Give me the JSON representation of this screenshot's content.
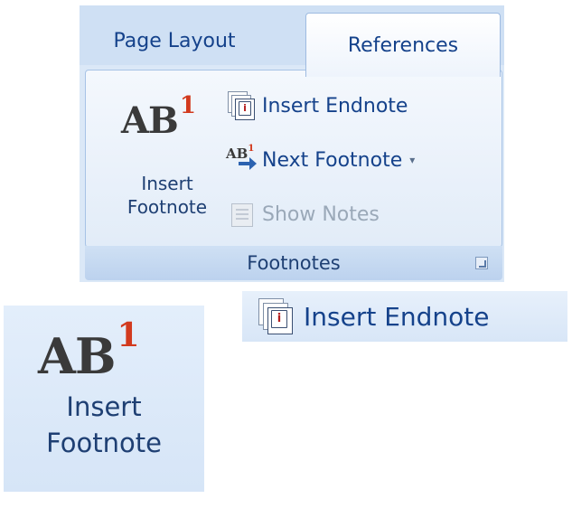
{
  "ribbon": {
    "tabs": [
      {
        "label": "Page Layout"
      },
      {
        "label": "References"
      }
    ],
    "group": {
      "label": "Footnotes",
      "insert_footnote": {
        "glyph": "AB",
        "superscript": "1",
        "label": "Insert\nFootnote",
        "icon": "ab-superscript-icon"
      },
      "insert_endnote": {
        "label": "Insert Endnote",
        "icon": "endnote-icon"
      },
      "next_footnote": {
        "label": "Next Footnote",
        "icon": "next-footnote-icon",
        "caret": "▾"
      },
      "show_notes": {
        "label": "Show Notes",
        "icon": "show-notes-icon",
        "enabled": false
      }
    }
  },
  "zoom": {
    "insert_footnote": {
      "glyph": "AB",
      "superscript": "1",
      "label": "Insert\nFootnote"
    },
    "insert_endnote": {
      "label": "Insert Endnote"
    }
  },
  "colors": {
    "accent_text": "#15428b",
    "superscript_red": "#d23a1e",
    "ribbon_bg": "#dbe8f7"
  }
}
